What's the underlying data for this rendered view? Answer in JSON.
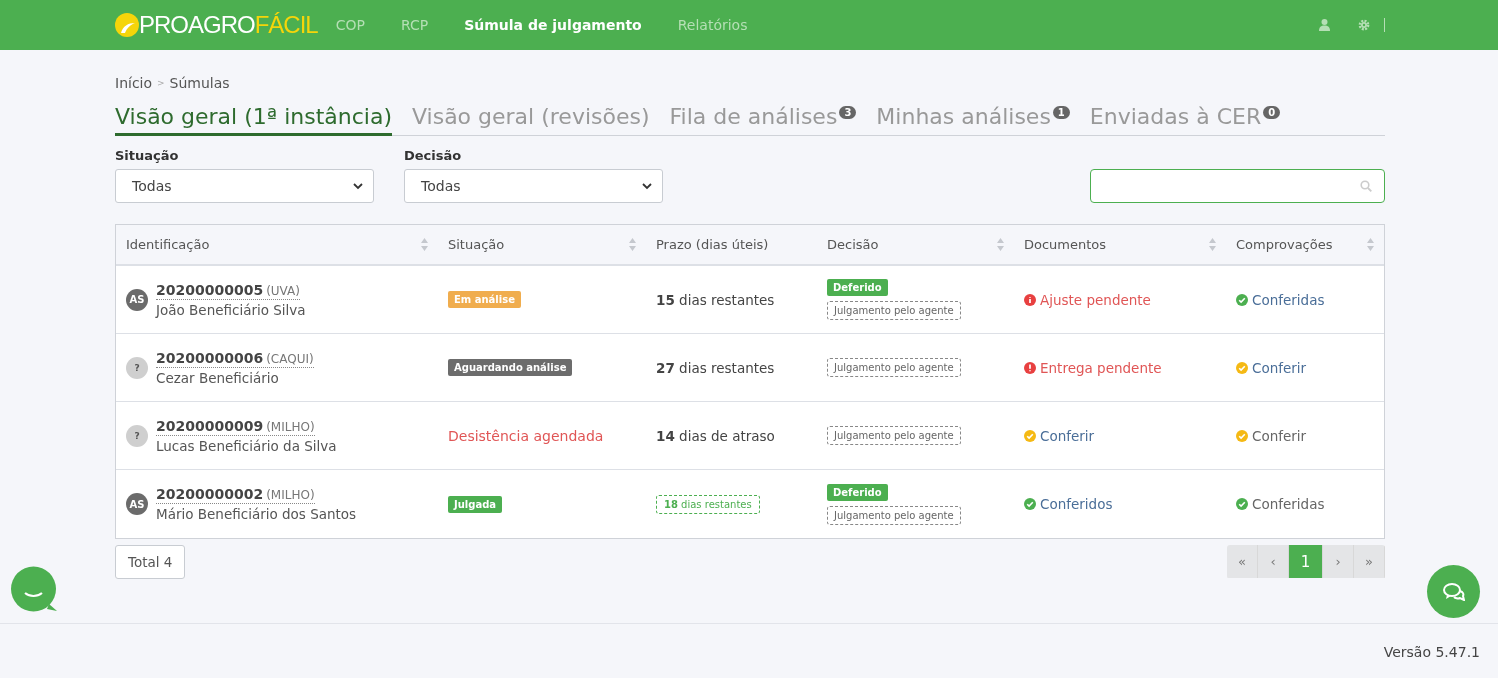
{
  "logo": [
    {
      "text": "PROAGRO",
      "kind": "base"
    },
    {
      "text": "FÁCIL",
      "kind": "accent"
    }
  ],
  "nav": [
    {
      "label": "COP",
      "selected": false
    },
    {
      "label": "RCP",
      "selected": false
    },
    {
      "label": "Súmula de julgamento",
      "selected": true
    },
    {
      "label": "Relatórios",
      "selected": false
    }
  ],
  "breadcrumb": {
    "items": [
      "Início",
      "Súmulas"
    ],
    "separator": ">"
  },
  "tabs": [
    {
      "label": "Visão geral (1ª instância)",
      "selected": true
    },
    {
      "label": "Visão geral (revisões)",
      "selected": false
    },
    {
      "label": "Fila de análises",
      "badge": "3",
      "selected": false
    },
    {
      "label": "Minhas análises",
      "badge": "1",
      "selected": false
    },
    {
      "label": "Enviadas à CER",
      "badge": "0",
      "selected": false
    }
  ],
  "filters": [
    {
      "label": "Situação",
      "value": "Todas"
    },
    {
      "label": "Decisão",
      "value": "Todas"
    }
  ],
  "table": {
    "columns": [
      {
        "label": "Identificação",
        "sortable": true
      },
      {
        "label": "Situação",
        "sortable": true
      },
      {
        "label": "Prazo (dias úteis)",
        "sortable": false
      },
      {
        "label": "Decisão",
        "sortable": true
      },
      {
        "label": "Documentos",
        "sortable": true
      },
      {
        "label": "Comprovações",
        "sortable": true
      }
    ],
    "rows": [
      {
        "avatar": {
          "text": "AS",
          "kind": "initials"
        },
        "id": "20200000005",
        "crop": "(UVA)",
        "name": "João Beneficiário Silva",
        "situation": {
          "kind": "badge",
          "text": "Em análise",
          "color": "#f0ad4e"
        },
        "deadline": {
          "kind": "plain",
          "number": "15",
          "text": "dias restantes"
        },
        "decision": {
          "badge": "Deferido",
          "tag": "Julgamento pelo agente"
        },
        "documents": {
          "kind": "info",
          "text": "Ajuste pendente"
        },
        "proofs": {
          "kind": "done",
          "text": "Conferidas"
        }
      },
      {
        "avatar": {
          "text": "?",
          "kind": "unknown"
        },
        "id": "20200000006",
        "crop": "(CAQUI)",
        "name": "Cezar Beneficiário",
        "situation": {
          "kind": "badge",
          "text": "Aguardando análise",
          "color": "#6c6c6c"
        },
        "deadline": {
          "kind": "plain",
          "number": "27",
          "text": "dias restantes"
        },
        "decision": {
          "tag": "Julgamento pelo agente"
        },
        "documents": {
          "kind": "alert",
          "text": "Entrega pendente"
        },
        "proofs": {
          "kind": "todo",
          "text": "Conferir"
        }
      },
      {
        "avatar": {
          "text": "?",
          "kind": "unknown"
        },
        "id": "20200000009",
        "crop": "(MILHO)",
        "name": "Lucas Beneficiário da Silva",
        "situation": {
          "kind": "text",
          "text": "Desistência agendada",
          "color": "#e05555"
        },
        "deadline": {
          "kind": "plain",
          "number": "14",
          "text": "dias de atraso"
        },
        "decision": {
          "tag": "Julgamento pelo agente"
        },
        "documents": {
          "kind": "todo",
          "text": "Conferir"
        },
        "proofs": {
          "kind": "waiting",
          "text": "Conferir"
        }
      },
      {
        "avatar": {
          "text": "AS",
          "kind": "initials"
        },
        "id": "20200000002",
        "crop": "(MILHO)",
        "name": "Mário Beneficiário dos Santos",
        "situation": {
          "kind": "badge",
          "text": "Julgada",
          "color": "#4caf50"
        },
        "deadline": {
          "kind": "outlined",
          "number": "18",
          "text": "dias restantes"
        },
        "decision": {
          "badge": "Deferido",
          "tag": "Julgamento pelo agente"
        },
        "documents": {
          "kind": "done",
          "text": "Conferidos"
        },
        "proofs": {
          "kind": "closed",
          "text": "Conferidas"
        }
      }
    ]
  },
  "total": "Total 4",
  "pagination": [
    {
      "label": "«",
      "selected": false,
      "disabled": true
    },
    {
      "label": "‹",
      "selected": false,
      "disabled": true
    },
    {
      "label": "1",
      "selected": true,
      "disabled": false
    },
    {
      "label": "›",
      "selected": false,
      "disabled": true
    },
    {
      "label": "»",
      "selected": false,
      "disabled": true
    }
  ],
  "version": "Versão 5.47.1"
}
